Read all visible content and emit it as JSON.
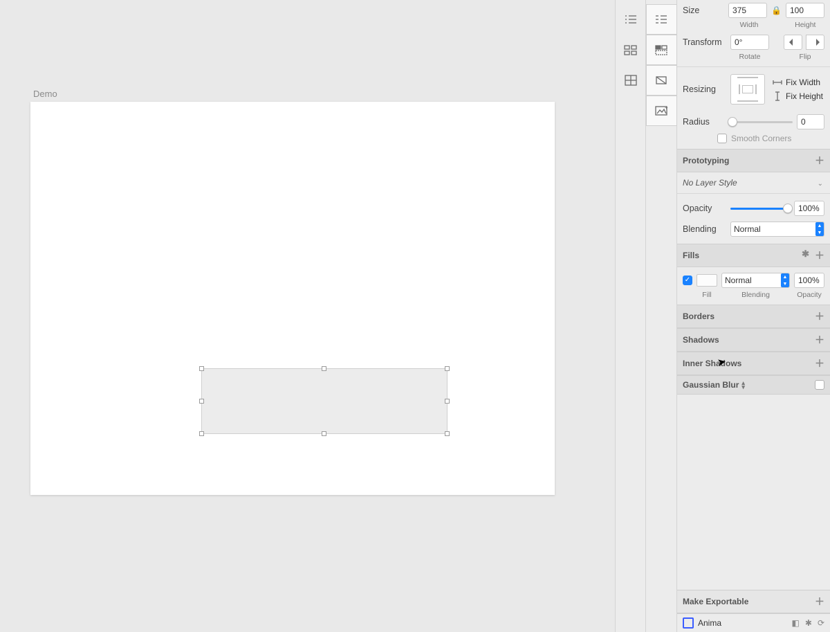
{
  "canvas": {
    "artboard_label": "Demo"
  },
  "panel": {
    "size_label": "Size",
    "width_value": "375",
    "width_sub": "Width",
    "height_value": "100",
    "height_sub": "Height",
    "transform_label": "Transform",
    "rotate_value": "0°",
    "rotate_sub": "Rotate",
    "flip_sub": "Flip",
    "resizing_label": "Resizing",
    "fix_width_label": "Fix Width",
    "fix_height_label": "Fix Height",
    "radius_label": "Radius",
    "radius_value": "0",
    "smooth_label": "Smooth Corners",
    "prototyping_label": "Prototyping",
    "layer_style": "No Layer Style",
    "opacity_label": "Opacity",
    "opacity_value": "100%",
    "blending_label": "Blending",
    "blending_value": "Normal",
    "fills_label": "Fills",
    "fill_sub": "Fill",
    "fill_blending": "Normal",
    "fill_blending_sub": "Blending",
    "fill_opacity": "100%",
    "fill_opacity_sub": "Opacity",
    "borders_label": "Borders",
    "shadows_label": "Shadows",
    "inner_shadows_label": "Inner Shadows",
    "gaussian_label": "Gaussian Blur",
    "exportable_label": "Make Exportable",
    "anima_label": "Anima"
  }
}
